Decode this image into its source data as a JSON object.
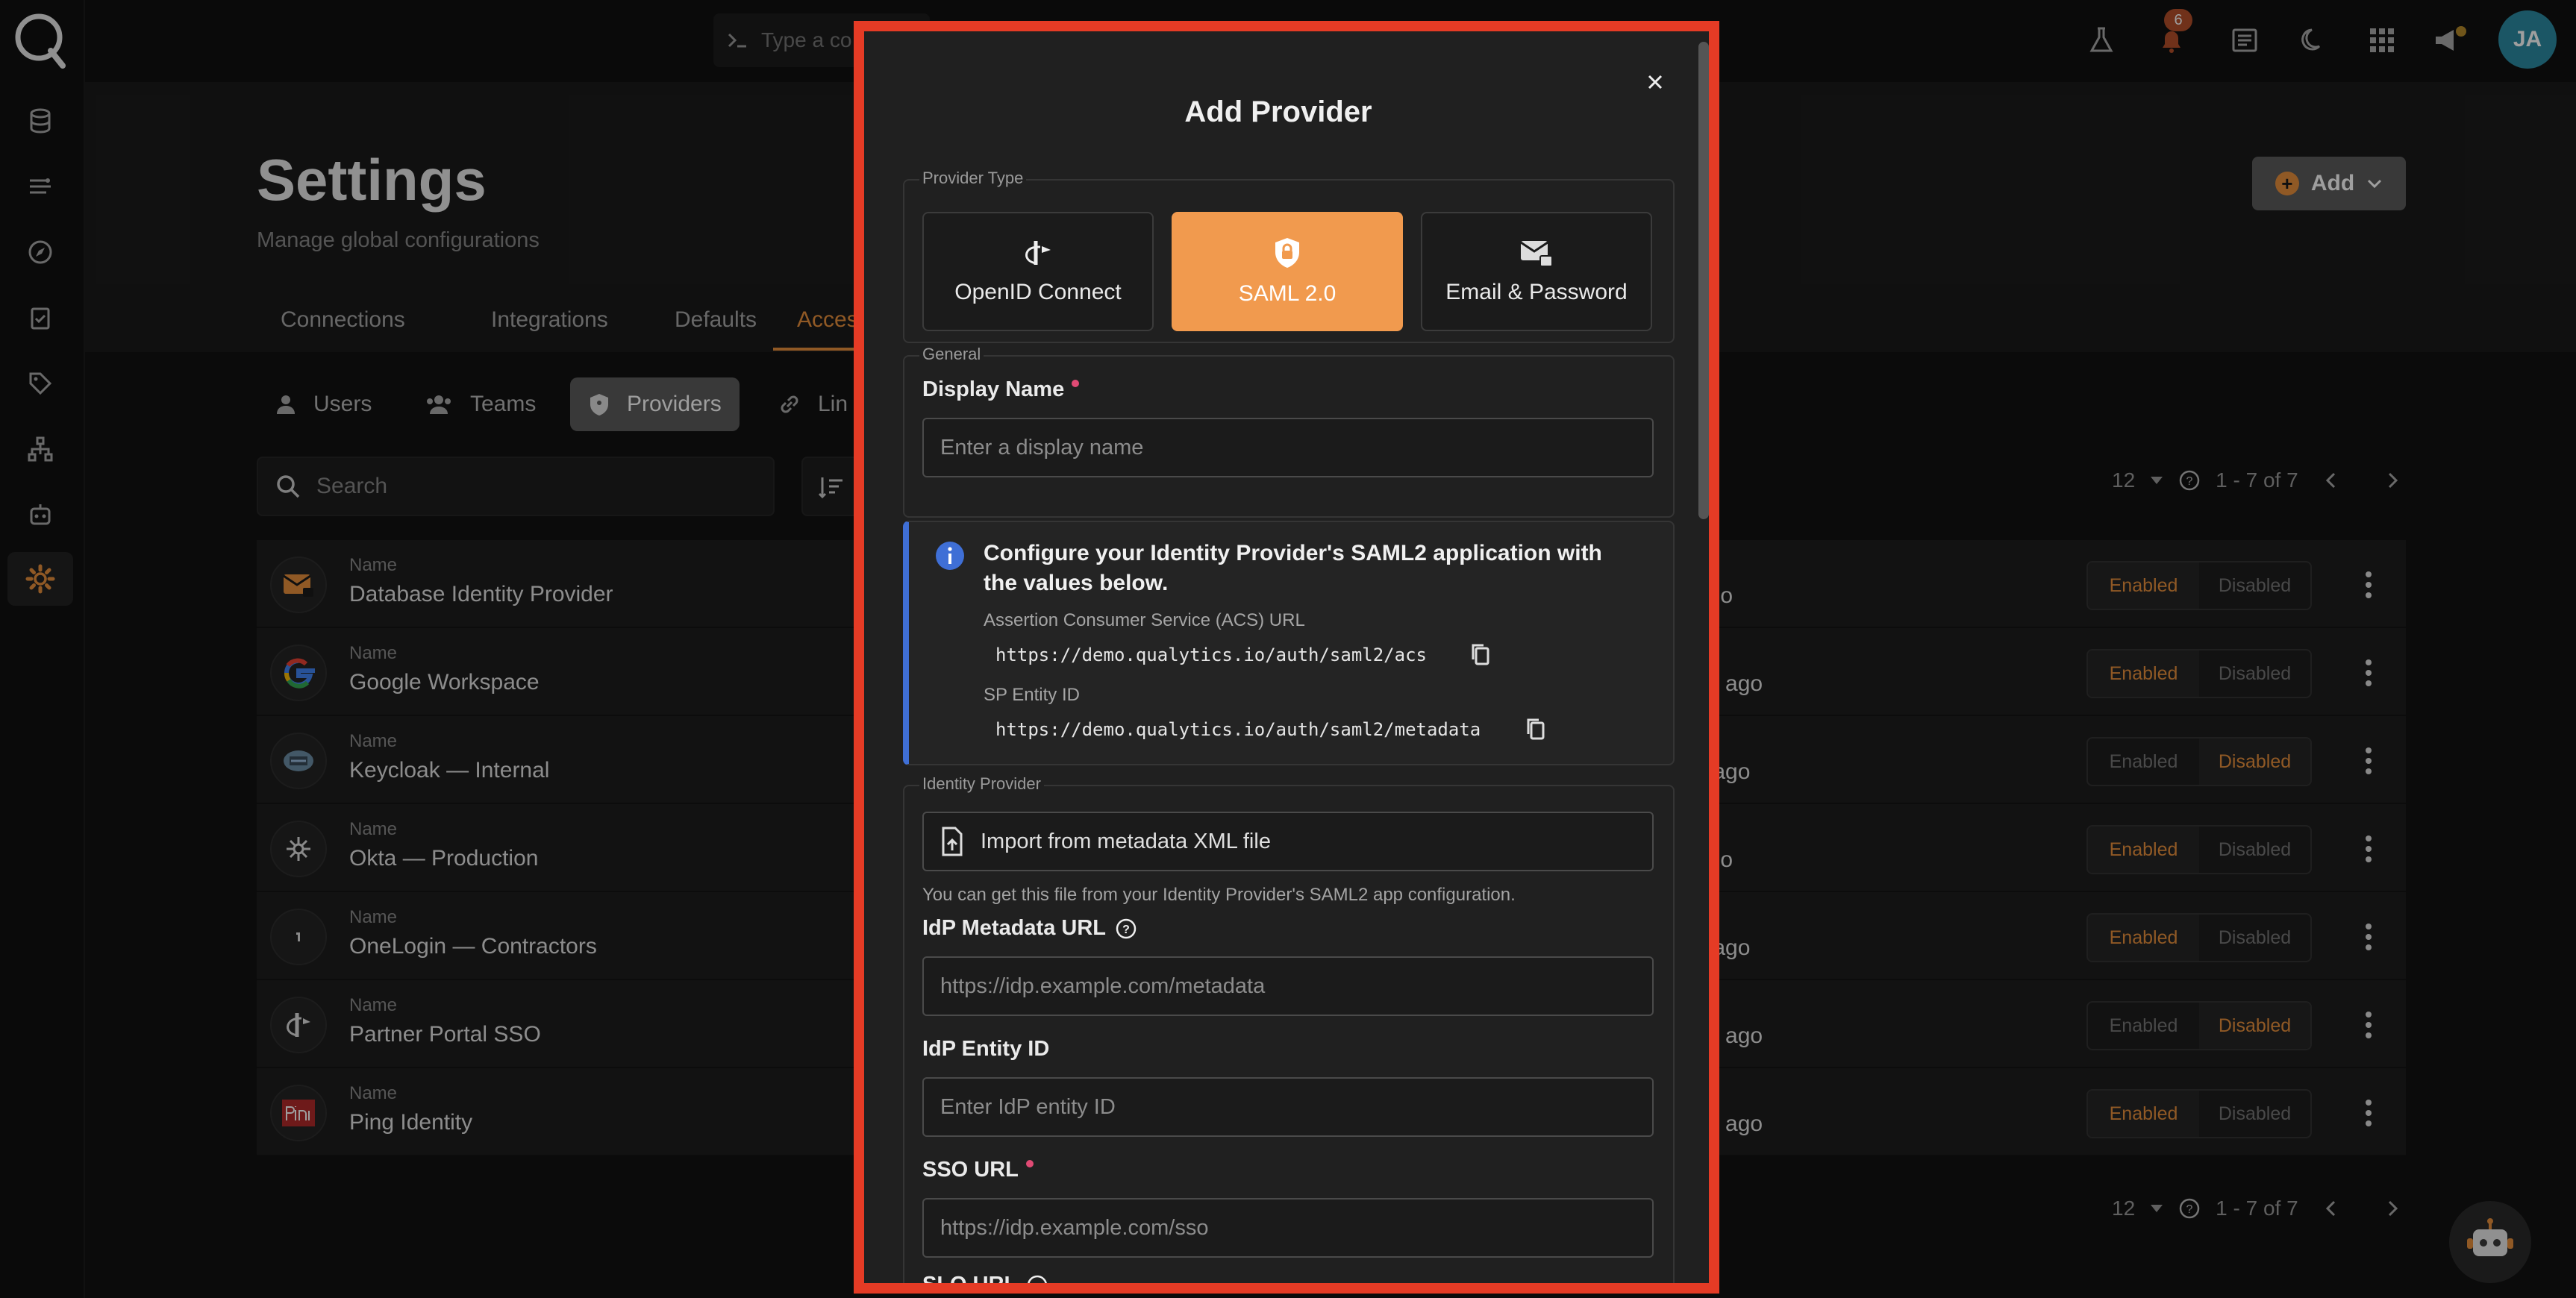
{
  "topbar": {
    "command_placeholder": "Type a co",
    "notifications_count": "6",
    "avatar_initials": "JA"
  },
  "page": {
    "title": "Settings",
    "subtitle": "Manage global configurations",
    "add_button": "Add",
    "tabs": [
      "Connections",
      "Integrations",
      "Defaults",
      "Acces"
    ],
    "subtabs": [
      "Users",
      "Teams",
      "Providers",
      "Lin"
    ],
    "search_placeholder": "Search",
    "page_size": "12",
    "range": "1 - 7 of 7"
  },
  "providers": {
    "name_label": "Name",
    "status_on": "Enabled",
    "status_off": "Disabled",
    "rows": [
      {
        "name": "Database Identity Provider",
        "ago": "ago",
        "enabled": true
      },
      {
        "name": "Google Workspace",
        "ago": "hs ago",
        "enabled": true
      },
      {
        "name": "Keycloak — Internal",
        "ago": "s ago",
        "enabled": false
      },
      {
        "name": "Okta — Production",
        "ago": "ago",
        "enabled": true
      },
      {
        "name": "OneLogin — Contractors",
        "ago": "s ago",
        "enabled": true
      },
      {
        "name": "Partner Portal SSO",
        "ago": "hs ago",
        "enabled": false
      },
      {
        "name": "Ping Identity",
        "ago": "hs ago",
        "enabled": true
      }
    ]
  },
  "modal": {
    "title": "Add Provider",
    "provider_type_legend": "Provider Type",
    "provider_types": [
      "OpenID Connect",
      "SAML 2.0",
      "Email & Password"
    ],
    "general_legend": "General",
    "display_name_label": "Display Name",
    "display_name_placeholder": "Enter a display name",
    "info_title": "Configure your Identity Provider's SAML2 application with the values below.",
    "acs_label": "Assertion Consumer Service (ACS) URL",
    "acs_value": "https://demo.qualytics.io/auth/saml2/acs",
    "entity_label": "SP Entity ID",
    "entity_value": "https://demo.qualytics.io/auth/saml2/metadata",
    "idp_legend": "Identity Provider",
    "import_label": "Import from metadata XML file",
    "import_hint": "You can get this file from your Identity Provider's SAML2 app configuration.",
    "metadata_url_label": "IdP Metadata URL",
    "metadata_url_placeholder": "https://idp.example.com/metadata",
    "entity_id_label": "IdP Entity ID",
    "entity_id_placeholder": "Enter IdP entity ID",
    "sso_url_label": "SSO URL",
    "sso_url_placeholder": "https://idp.example.com/sso",
    "slo_url_label": "SLO URL"
  },
  "colors": {
    "accent": "#e8903d",
    "frame": "#e53b25",
    "info": "#3f6fd6"
  }
}
